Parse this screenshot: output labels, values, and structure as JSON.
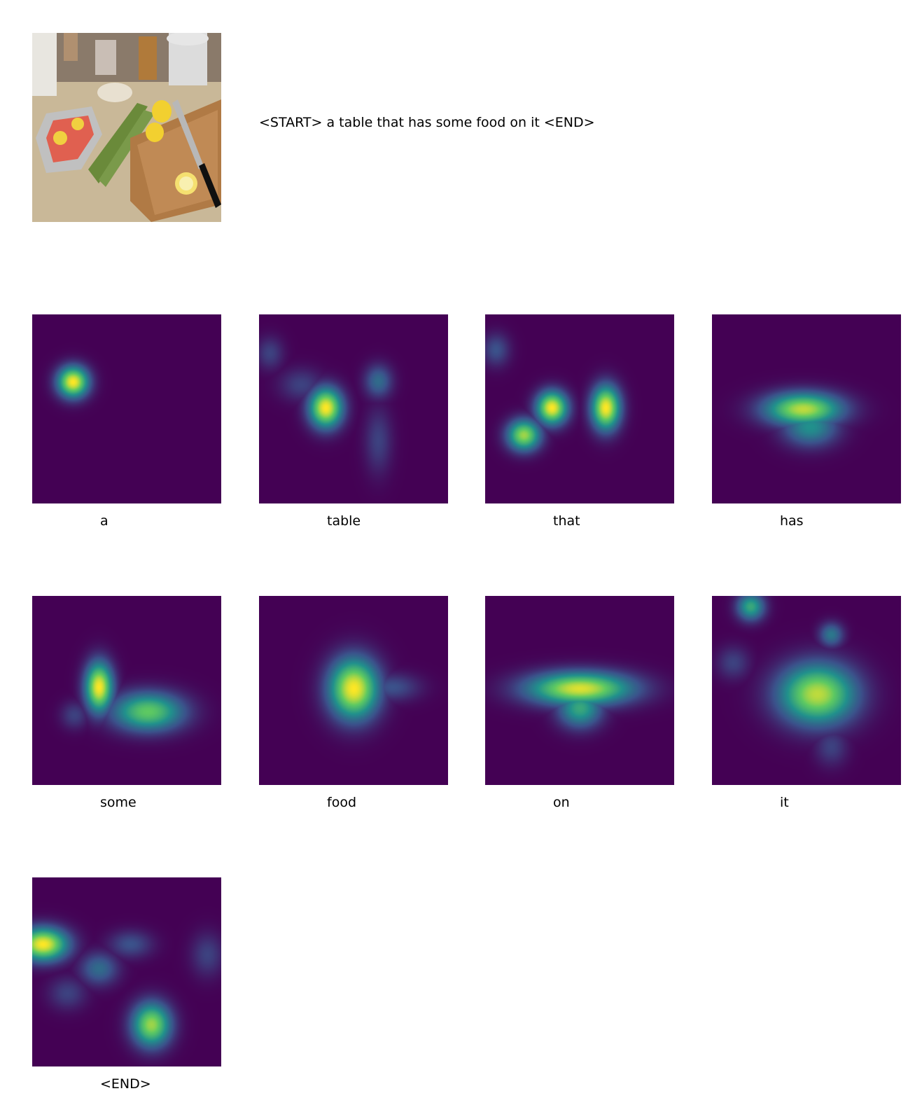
{
  "image": {
    "description_icon": "kitchen-counter-photo"
  },
  "caption": "<START> a table that has some food on it <END>",
  "attention_words": [
    "a",
    "table",
    "that",
    "has",
    "some",
    "food",
    "on",
    "it",
    "<END>"
  ],
  "colors": {
    "background": "#ffffff",
    "heatmap_low": "#440154",
    "heatmap_mid": "#21918c",
    "heatmap_high": "#fde725"
  }
}
